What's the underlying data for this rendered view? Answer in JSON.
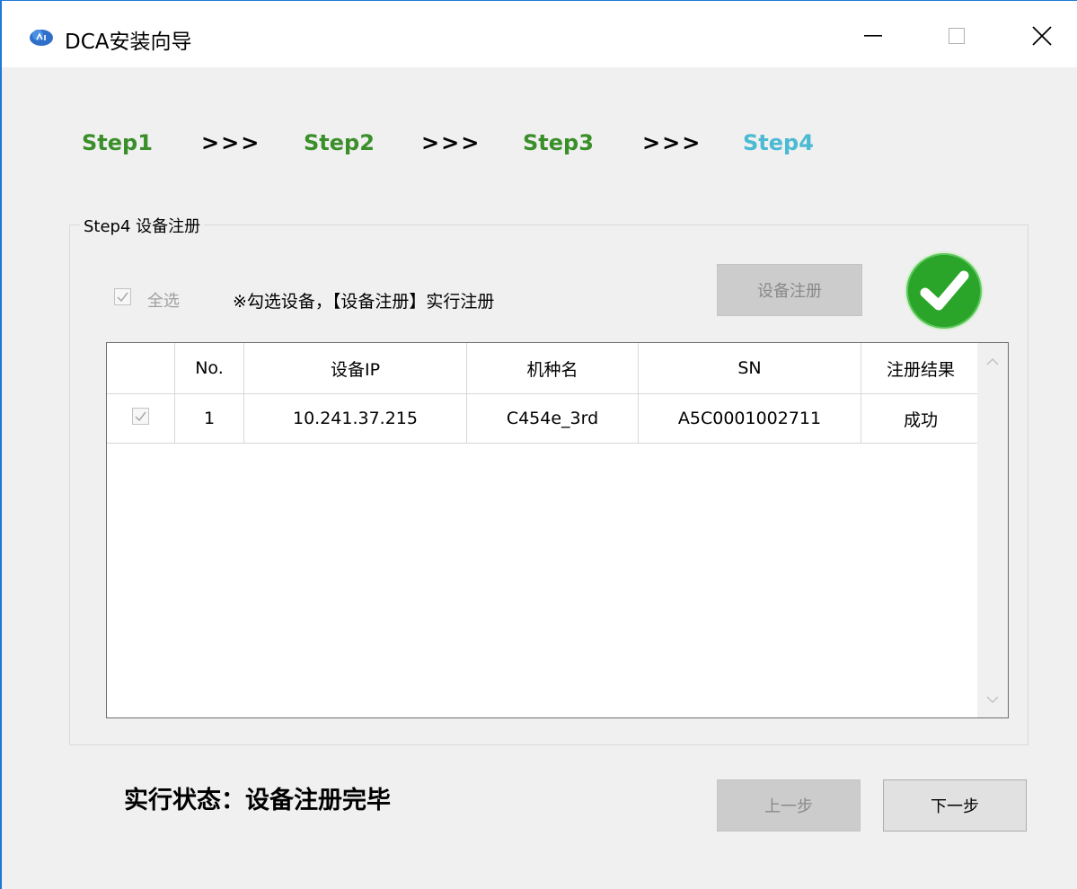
{
  "window": {
    "title": "DCA安装向导",
    "icon": "app-cloud-icon"
  },
  "steps": {
    "items": [
      "Step1",
      "Step2",
      "Step3",
      "Step4"
    ],
    "separator": ">>>",
    "current_index": 3,
    "done_color": "#3a8f2a",
    "current_color": "#4bbad3"
  },
  "group": {
    "legend": "Step4 设备注册",
    "select_all_label": "全选",
    "select_all_checked": true,
    "hint": "※勾选设备，【设备注册】实行注册",
    "register_button": "设备注册",
    "status_icon": "success-check-icon"
  },
  "table": {
    "columns": [
      "",
      "No.",
      "设备IP",
      "机种名",
      "SN",
      "注册结果"
    ],
    "rows": [
      {
        "checked": true,
        "no": "1",
        "ip": "10.241.37.215",
        "model": "C454e_3rd",
        "sn": "A5C0001002711",
        "result": "成功"
      }
    ]
  },
  "footer": {
    "status": "实行状态：设备注册完毕",
    "prev_button": "上一步",
    "next_button": "下一步"
  },
  "colors": {
    "accent_border": "#1e78d7",
    "success": "#2aa52a"
  }
}
